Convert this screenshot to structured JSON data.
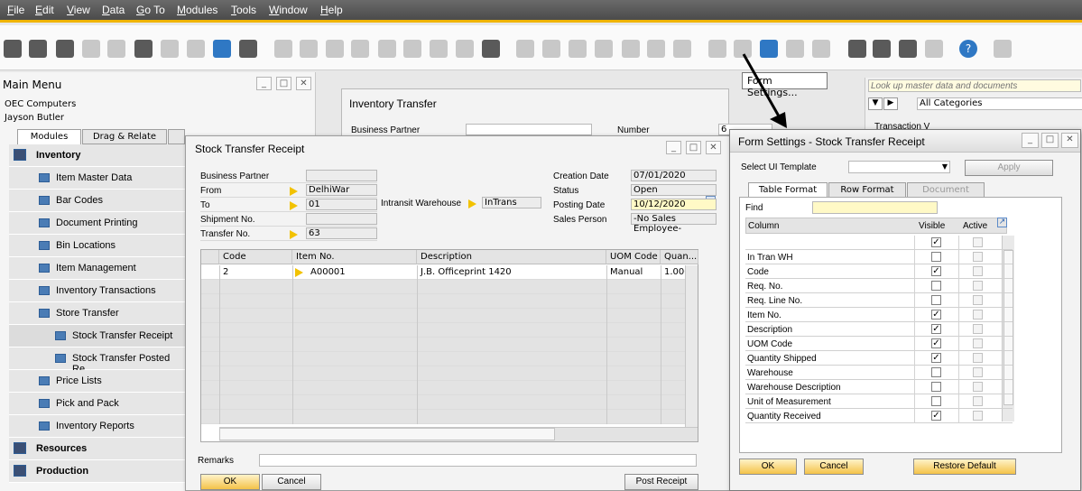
{
  "menubar": {
    "items": [
      {
        "label": "File",
        "key": "F",
        "rest": "ile"
      },
      {
        "label": "Edit",
        "key": "E",
        "rest": "dit"
      },
      {
        "label": "View",
        "key": "V",
        "rest": "iew"
      },
      {
        "label": "Data",
        "key": "D",
        "rest": "ata"
      },
      {
        "label": "Go To",
        "key": "G",
        "rest": "o To"
      },
      {
        "label": "Modules",
        "key": "M",
        "rest": "odules"
      },
      {
        "label": "Tools",
        "key": "T",
        "rest": "ools"
      },
      {
        "label": "Window",
        "key": "W",
        "rest": "indow"
      },
      {
        "label": "Help",
        "key": "H",
        "rest": "elp"
      }
    ]
  },
  "tooltip": "Form Settings...",
  "main_menu": {
    "title": "Main Menu",
    "company": "OEC Computers",
    "user": "Jayson Butler",
    "tabs": [
      "Modules",
      "Drag & Relate"
    ],
    "items": [
      {
        "label": "Inventory",
        "level": 0
      },
      {
        "label": "Item Master Data",
        "level": 1
      },
      {
        "label": "Bar Codes",
        "level": 1
      },
      {
        "label": "Document Printing",
        "level": 1
      },
      {
        "label": "Bin Locations",
        "level": 1
      },
      {
        "label": "Item Management",
        "level": 1
      },
      {
        "label": "Inventory Transactions",
        "level": 1
      },
      {
        "label": "Store Transfer",
        "level": 1
      },
      {
        "label": "Stock Transfer Receipt",
        "level": 2
      },
      {
        "label": "Stock Transfer Posted Re",
        "level": 2
      },
      {
        "label": "Price Lists",
        "level": 1
      },
      {
        "label": "Pick and Pack",
        "level": 1
      },
      {
        "label": "Inventory Reports",
        "level": 1
      },
      {
        "label": "Resources",
        "level": 0
      },
      {
        "label": "Production",
        "level": 0
      }
    ]
  },
  "inventory_transfer": {
    "title": "Inventory Transfer",
    "business_partner_label": "Business Partner",
    "number_label": "Number",
    "number_value": "6"
  },
  "search_panel": {
    "placeholder": "Look up master data and documents",
    "category": "All Categories",
    "partial_label": "Transaction V"
  },
  "stock_transfer_receipt": {
    "title": "Stock Transfer Receipt",
    "header_left": [
      {
        "label": "Business Partner",
        "value": "",
        "arrow": false
      },
      {
        "label": "From",
        "value": "DelhiWar",
        "arrow": true
      },
      {
        "label": "To",
        "value": "01",
        "arrow": true
      },
      {
        "label": "Shipment No.",
        "value": "",
        "arrow": false
      },
      {
        "label": "Transfer No.",
        "value": "63",
        "arrow": true
      }
    ],
    "intransit_label": "Intransit Warehouse",
    "intransit_value": "InTrans",
    "header_right": [
      {
        "label": "Creation Date",
        "value": "07/01/2020"
      },
      {
        "label": "Status",
        "value": "Open"
      },
      {
        "label": "Posting Date",
        "value": "10/12/2020"
      },
      {
        "label": "Sales Person",
        "value": "-No Sales Employee-"
      }
    ],
    "grid": {
      "columns": [
        "Code",
        "Item No.",
        "Description",
        "UOM Code",
        "Quan..."
      ],
      "rows": [
        {
          "code": "2",
          "item_no": "A00001",
          "description": "J.B. Officeprint 1420",
          "uom": "Manual",
          "qty": "1.000"
        }
      ]
    },
    "remarks_label": "Remarks",
    "ok_label": "OK",
    "cancel_label": "Cancel",
    "post_receipt_label": "Post Receipt"
  },
  "form_settings": {
    "title": "Form Settings - Stock Transfer Receipt",
    "select_template_label": "Select UI Template",
    "apply_label": "Apply",
    "tabs": [
      "Table Format",
      "Row Format",
      "Document"
    ],
    "find_label": "Find",
    "col_header": "Column",
    "visible_header": "Visible",
    "active_header": "Active",
    "rows": [
      {
        "name": "",
        "visible": true
      },
      {
        "name": "In Tran WH",
        "visible": false
      },
      {
        "name": "Code",
        "visible": true
      },
      {
        "name": "Req. No.",
        "visible": false
      },
      {
        "name": "Req. Line No.",
        "visible": false
      },
      {
        "name": "Item No.",
        "visible": true
      },
      {
        "name": "Description",
        "visible": true
      },
      {
        "name": "UOM Code",
        "visible": true
      },
      {
        "name": "Quantity Shipped",
        "visible": true
      },
      {
        "name": "Warehouse",
        "visible": false
      },
      {
        "name": "Warehouse Description",
        "visible": false
      },
      {
        "name": "Unit of Measurement",
        "visible": false
      },
      {
        "name": "Quantity Received",
        "visible": true
      }
    ],
    "ok_label": "OK",
    "cancel_label": "Cancel",
    "restore_label": "Restore Default"
  },
  "colors": {
    "accent": "#f0b400",
    "menubar": "#555555",
    "yellow_field": "#fff9c6"
  }
}
